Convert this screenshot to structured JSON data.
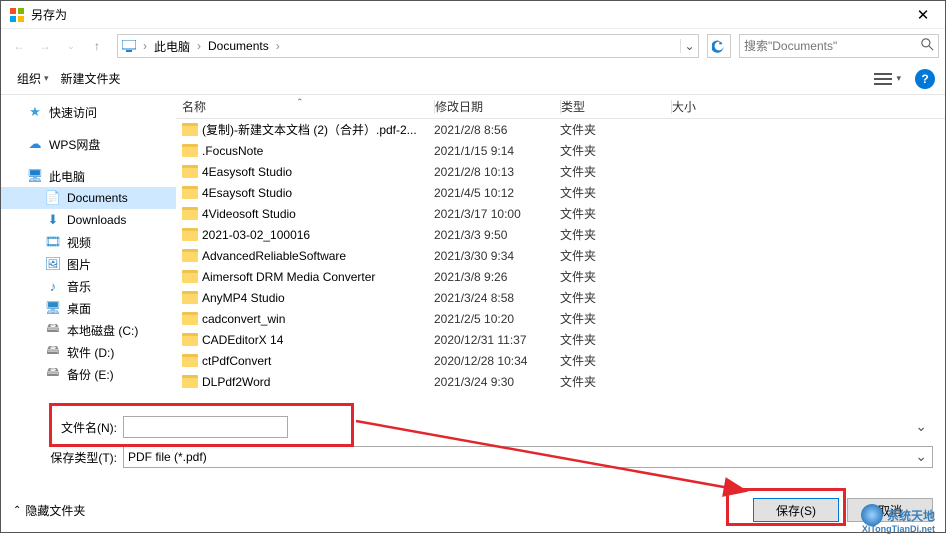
{
  "window": {
    "title": "另存为"
  },
  "breadcrumb": {
    "root": "此电脑",
    "folder": "Documents"
  },
  "search": {
    "placeholder": "搜索\"Documents\""
  },
  "toolbar": {
    "organize": "组织",
    "new_folder": "新建文件夹"
  },
  "columns": {
    "name": "名称",
    "date": "修改日期",
    "type": "类型",
    "size": "大小"
  },
  "sidebar": {
    "quick": "快速访问",
    "wps": "WPS网盘",
    "pc": "此电脑",
    "docs": "Documents",
    "downloads": "Downloads",
    "videos": "视频",
    "pictures": "图片",
    "music": "音乐",
    "desktop": "桌面",
    "disk_c": "本地磁盘 (C:)",
    "disk_d": "软件 (D:)",
    "disk_e": "备份 (E:)"
  },
  "files": [
    {
      "name": "(复制)-新建文本文档 (2)（合并）.pdf-2...",
      "date": "2021/2/8 8:56",
      "type": "文件夹"
    },
    {
      "name": ".FocusNote",
      "date": "2021/1/15 9:14",
      "type": "文件夹"
    },
    {
      "name": "4Easysoft Studio",
      "date": "2021/2/8 10:13",
      "type": "文件夹"
    },
    {
      "name": "4Esaysoft Studio",
      "date": "2021/4/5 10:12",
      "type": "文件夹"
    },
    {
      "name": "4Videosoft Studio",
      "date": "2021/3/17 10:00",
      "type": "文件夹"
    },
    {
      "name": "2021-03-02_100016",
      "date": "2021/3/3 9:50",
      "type": "文件夹"
    },
    {
      "name": "AdvancedReliableSoftware",
      "date": "2021/3/30 9:34",
      "type": "文件夹"
    },
    {
      "name": "Aimersoft DRM Media Converter",
      "date": "2021/3/8 9:26",
      "type": "文件夹"
    },
    {
      "name": "AnyMP4 Studio",
      "date": "2021/3/24 8:58",
      "type": "文件夹"
    },
    {
      "name": "cadconvert_win",
      "date": "2021/2/5 10:20",
      "type": "文件夹"
    },
    {
      "name": "CADEditorX 14",
      "date": "2020/12/31 11:37",
      "type": "文件夹"
    },
    {
      "name": "ctPdfConvert",
      "date": "2020/12/28 10:34",
      "type": "文件夹"
    },
    {
      "name": "DLPdf2Word",
      "date": "2021/3/24 9:30",
      "type": "文件夹"
    }
  ],
  "form": {
    "filename_label": "文件名(N):",
    "filename_value": "",
    "filetype_label": "保存类型(T):",
    "filetype_value": "PDF file (*.pdf)"
  },
  "footer": {
    "hide": "隐藏文件夹",
    "save": "保存(S)",
    "cancel": "取消"
  },
  "watermark": {
    "text": "系统天地",
    "sub": "XiTongTianDi.net"
  }
}
